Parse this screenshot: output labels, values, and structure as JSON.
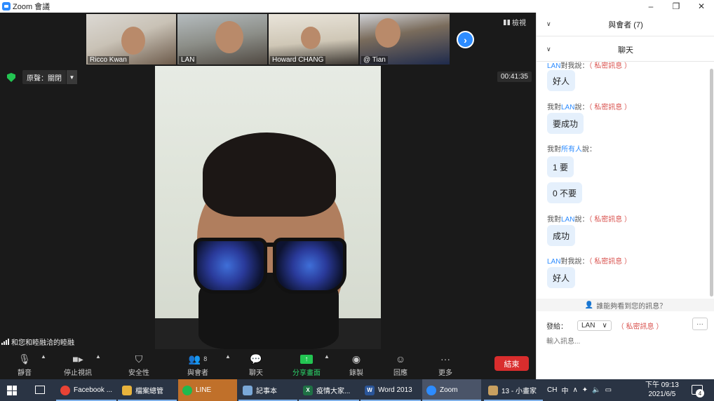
{
  "window": {
    "title": "Zoom 會議",
    "minimize": "–",
    "restore": "❐",
    "close": "✕"
  },
  "thumbnails": [
    {
      "name": "Ricco Kwan"
    },
    {
      "name": "LAN"
    },
    {
      "name": "Howard CHANG"
    },
    {
      "name": "@ Tian"
    }
  ],
  "view_label": "檢視",
  "audio": {
    "label": "原聲：關閉"
  },
  "timer": "00:41:35",
  "network_status": "和您和睦融洽的睦融",
  "toolbar": {
    "mute": "靜音",
    "stop_video": "停止視訊",
    "security": "安全性",
    "participants": "與會者",
    "participants_count": "8",
    "chat": "聊天",
    "share": "分享畫面",
    "record": "錄製",
    "reactions": "回應",
    "more": "更多",
    "end": "結束"
  },
  "panel": {
    "participants_header": "與會者 (7)",
    "chat_header": "聊天",
    "messages": [
      {
        "header_who": "LAN",
        "header_text": "對我說：",
        "private": "（ 私密訊息 ）",
        "body": "好人"
      },
      {
        "header_prefix": "我對",
        "header_who": "LAN",
        "header_text": "說：",
        "private": "（ 私密訊息 ）",
        "body": "要成功"
      },
      {
        "header_prefix": "我對",
        "header_who": "所有人",
        "header_text": "說：",
        "private": "",
        "body": "1 要"
      },
      {
        "body": "0 不要"
      },
      {
        "header_prefix": "我對",
        "header_who": "LAN",
        "header_text": "說：",
        "private": "（ 私密訊息 ）",
        "body": "成功"
      },
      {
        "header_who": "LAN",
        "header_text": "對我說：",
        "private": "（ 私密訊息 ）",
        "body": "好人"
      }
    ],
    "who_can_see": "誰能夠看到您的訊息？",
    "send_to_label": "發給：",
    "send_to_value": "LAN",
    "send_private": "（ 私密訊息 ）",
    "more": "···",
    "input_placeholder": "輸入訊息..."
  },
  "taskbar": {
    "apps": [
      {
        "label": "Facebook ...",
        "icon": "chrome-icon",
        "color": "#e94335"
      },
      {
        "label": "檔案總管",
        "icon": "folder-icon",
        "color": "#e8b33c"
      },
      {
        "label": "LINE",
        "icon": "line-icon",
        "color": "#1fb94e"
      },
      {
        "label": "記事本",
        "icon": "notepad-icon",
        "color": "#7aa8d8"
      },
      {
        "label": "疫情大家...",
        "icon": "excel-icon",
        "color": "#1f7145"
      },
      {
        "label": "Word 2013",
        "icon": "word-icon",
        "color": "#2a5599"
      },
      {
        "label": "Zoom",
        "icon": "zoom-icon",
        "color": "#2D8CFF"
      },
      {
        "label": "13 - 小畫家",
        "icon": "paint-icon",
        "color": "#c8a060"
      }
    ],
    "ime": "CH",
    "ime_mode": "中",
    "clock_time": "下午 09:13",
    "clock_date": "2021/6/5",
    "notifications": "4"
  }
}
